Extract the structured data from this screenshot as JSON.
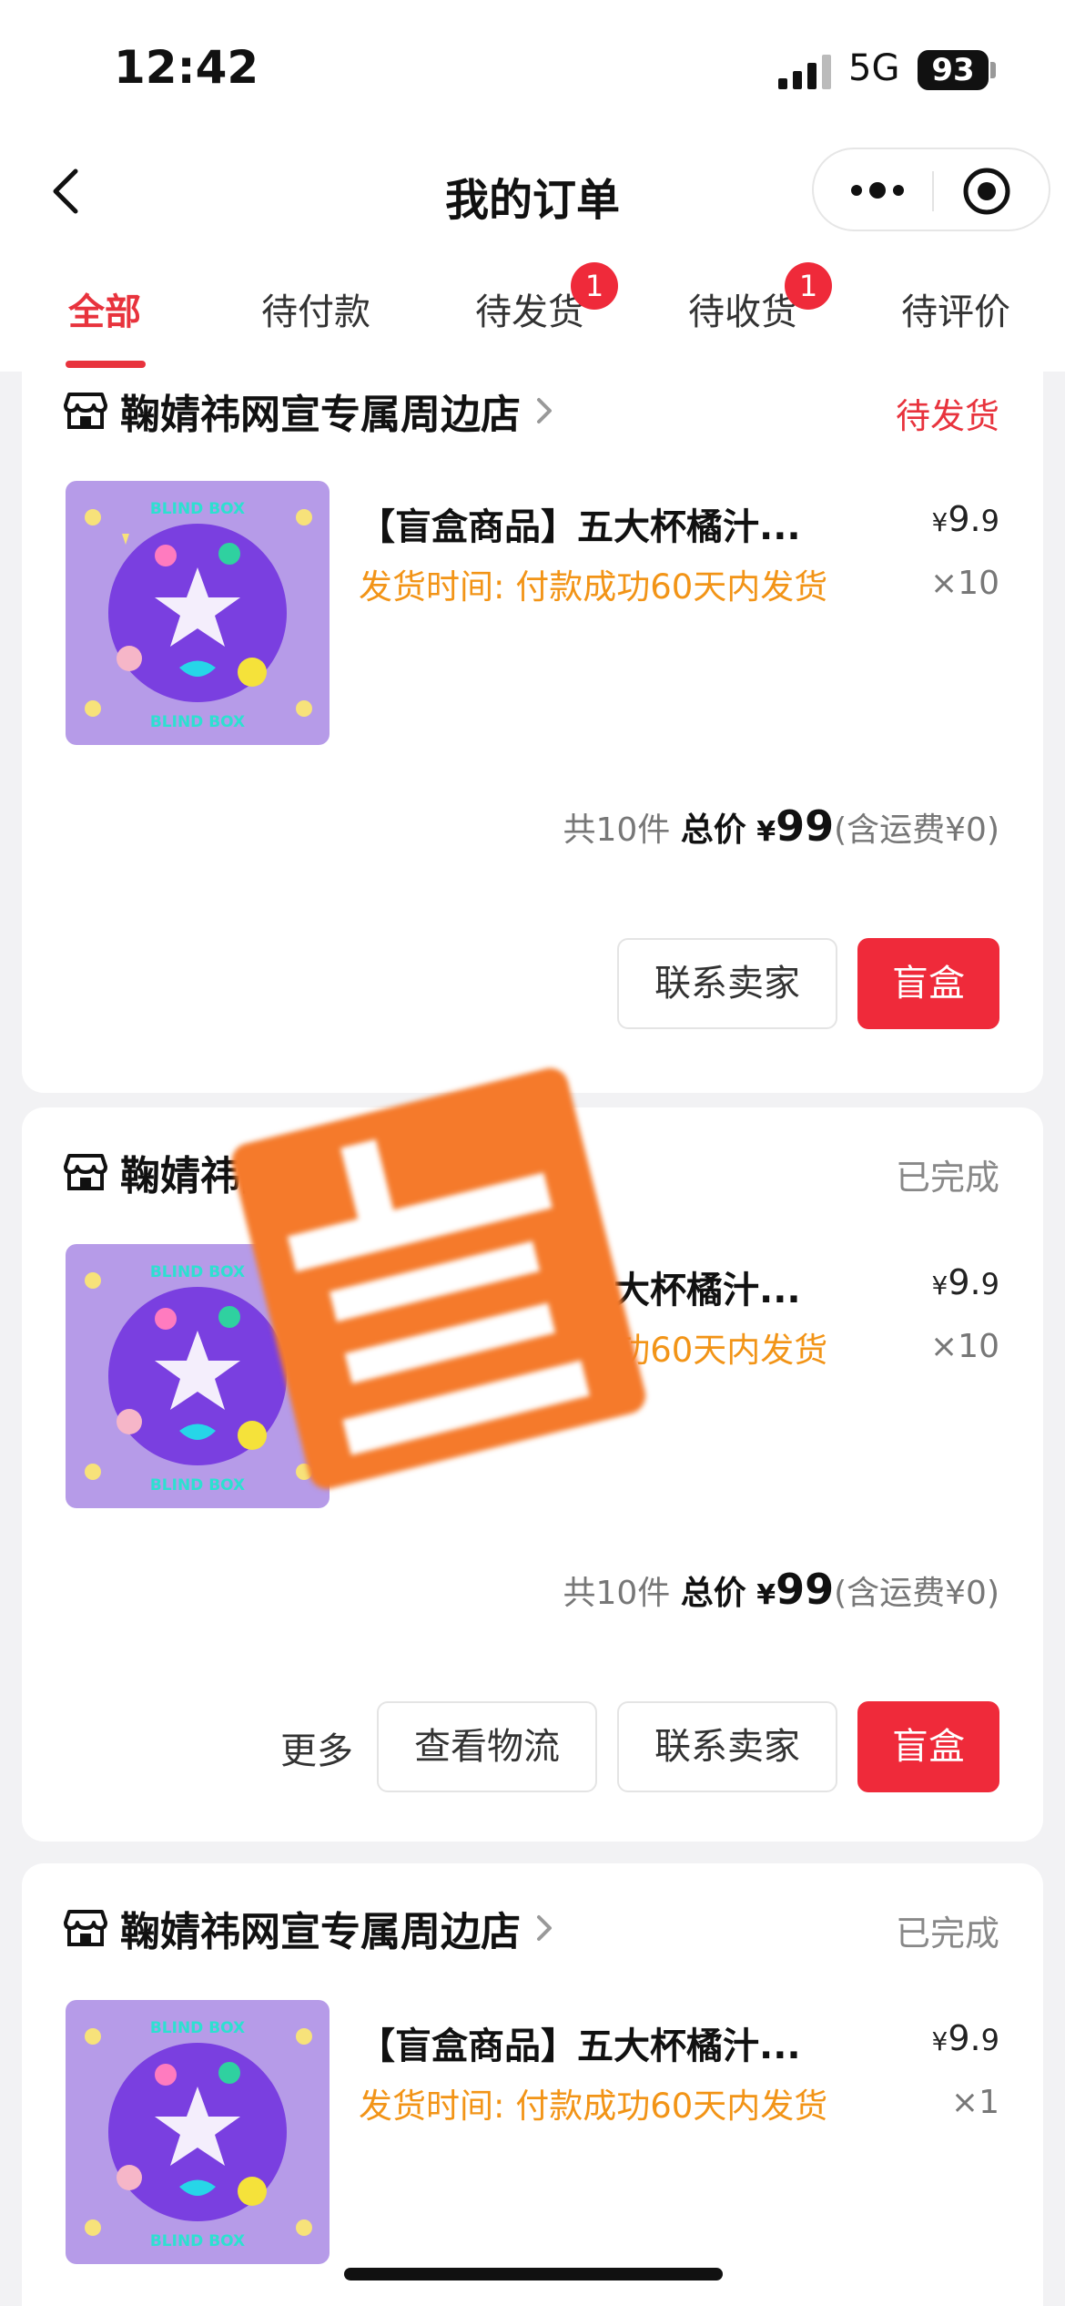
{
  "status_bar": {
    "time": "12:42",
    "network": "5G",
    "battery": "93"
  },
  "nav": {
    "title": "我的订单"
  },
  "tabs": [
    {
      "label": "全部",
      "active": true
    },
    {
      "label": "待付款"
    },
    {
      "label": "待发货",
      "badge": "1"
    },
    {
      "label": "待收货",
      "badge": "1"
    },
    {
      "label": "待评价"
    }
  ],
  "orders": [
    {
      "shop": "鞠婧祎网宣专属周边店",
      "status": "待发货",
      "title": "【盲盒商品】五大杯橘汁...",
      "ship_note": "发货时间: 付款成功60天内发货",
      "price_yen": "¥",
      "price_int": "9.",
      "price_dec": "9",
      "qty": "×10",
      "count": "共10件",
      "total_label": "总价",
      "total_yen": "¥",
      "total_amount": "99",
      "shipping": "(含运费¥0)",
      "buttons": {
        "contact": "联系卖家",
        "primary": "盲盒"
      }
    },
    {
      "shop": "鞠婧祎网宣专属周边店",
      "status": "已完成",
      "title": "【盲盒商品】五大杯橘汁...",
      "ship_note": "发货时间: 付款成功60天内发货",
      "price_yen": "¥",
      "price_int": "9.",
      "price_dec": "9",
      "qty": "×10",
      "count": "共10件",
      "total_label": "总价",
      "total_yen": "¥",
      "total_amount": "99",
      "shipping": "(含运费¥0)",
      "buttons": {
        "more": "更多",
        "logistics": "查看物流",
        "contact": "联系卖家",
        "primary": "盲盒"
      }
    },
    {
      "shop": "鞠婧祎网宣专属周边店",
      "status": "已完成",
      "title": "【盲盒商品】五大杯橘汁...",
      "ship_note": "发货时间: 付款成功60天内发货",
      "price_yen": "¥",
      "price_int": "9.",
      "price_dec": "9",
      "qty": "×1"
    }
  ],
  "thumb_text": {
    "top": "BLIND BOX",
    "bottom": "BLIND BOX"
  },
  "colors": {
    "accent": "#ef2a3a",
    "warning": "#f29417",
    "stamp": "#f57a2b"
  }
}
